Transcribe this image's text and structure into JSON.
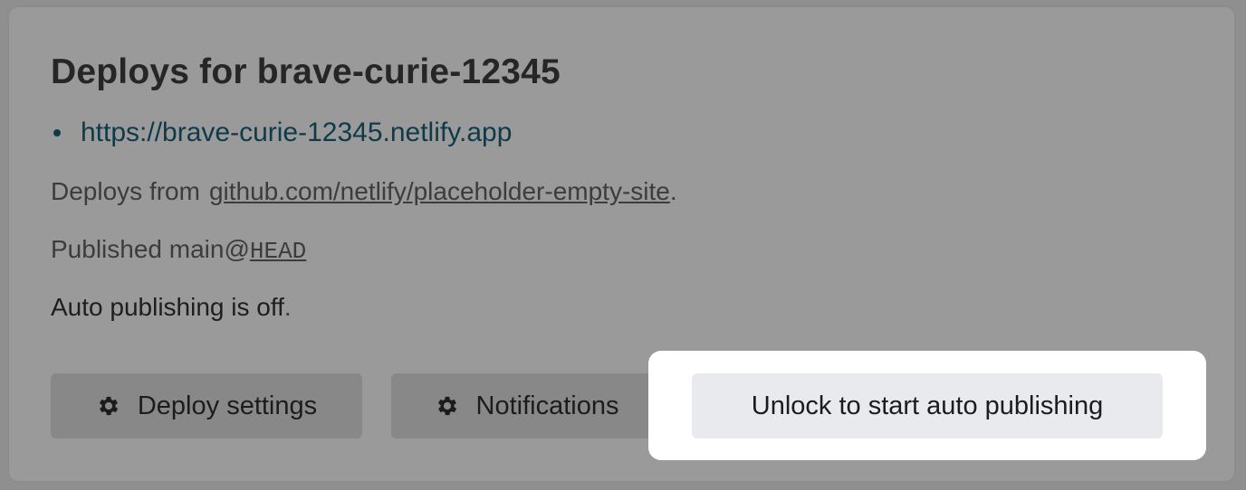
{
  "header": {
    "title": "Deploys for brave-curie-12345"
  },
  "site": {
    "url": "https://brave-curie-12345.netlify.app"
  },
  "deploy_info": {
    "deploys_from_label": "Deploys from",
    "repo": "github.com/netlify/placeholder-empty-site",
    "repo_suffix": ".",
    "published_label": "Published main@",
    "published_ref": "HEAD",
    "auto_publishing_text": "Auto publishing is off",
    "auto_publishing_suffix": "."
  },
  "actions": {
    "deploy_settings_label": "Deploy settings",
    "deploy_settings_icon": "gear-icon",
    "notifications_label": "Notifications",
    "notifications_icon": "gear-icon",
    "unlock_label": "Unlock to start auto publishing"
  },
  "colors": {
    "overlay": "#8f8f8f",
    "link": "#0e3a4a",
    "highlight": "#ffffff",
    "unlock_button_bg": "#e9eaee"
  }
}
